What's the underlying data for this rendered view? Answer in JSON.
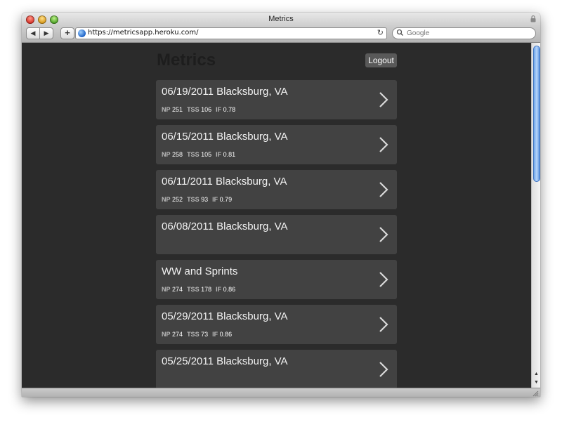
{
  "window": {
    "title": "Metrics"
  },
  "toolbar": {
    "back_icon": "◀",
    "forward_icon": "▶",
    "add_icon": "+",
    "url": "https://metricsapp.heroku.com/",
    "reload_icon": "↻",
    "search_placeholder": "Google"
  },
  "page": {
    "title": "Metrics",
    "logout_label": "Logout"
  },
  "workouts": [
    {
      "title": "06/19/2011 Blacksburg, VA",
      "stats": [
        {
          "label": "NP",
          "value": "251"
        },
        {
          "label": "TSS",
          "value": "106"
        },
        {
          "label": "IF",
          "value": "0.78"
        }
      ]
    },
    {
      "title": "06/15/2011 Blacksburg, VA",
      "stats": [
        {
          "label": "NP",
          "value": "258"
        },
        {
          "label": "TSS",
          "value": "105"
        },
        {
          "label": "IF",
          "value": "0.81"
        }
      ]
    },
    {
      "title": "06/11/2011 Blacksburg, VA",
      "stats": [
        {
          "label": "NP",
          "value": "252"
        },
        {
          "label": "TSS",
          "value": "93"
        },
        {
          "label": "IF",
          "value": "0.79"
        }
      ]
    },
    {
      "title": "06/08/2011 Blacksburg, VA",
      "stats": []
    },
    {
      "title": "WW and Sprints",
      "stats": [
        {
          "label": "NP",
          "value": "274"
        },
        {
          "label": "TSS",
          "value": "178"
        },
        {
          "label": "IF",
          "value": "0.86"
        }
      ]
    },
    {
      "title": "05/29/2011 Blacksburg, VA",
      "stats": [
        {
          "label": "NP",
          "value": "274"
        },
        {
          "label": "TSS",
          "value": "73"
        },
        {
          "label": "IF",
          "value": "0.86"
        }
      ]
    },
    {
      "title": "05/25/2011 Blacksburg, VA",
      "stats": []
    }
  ],
  "colors": {
    "background": "#2b2b2b",
    "card": "#424242",
    "logout": "#595959"
  }
}
